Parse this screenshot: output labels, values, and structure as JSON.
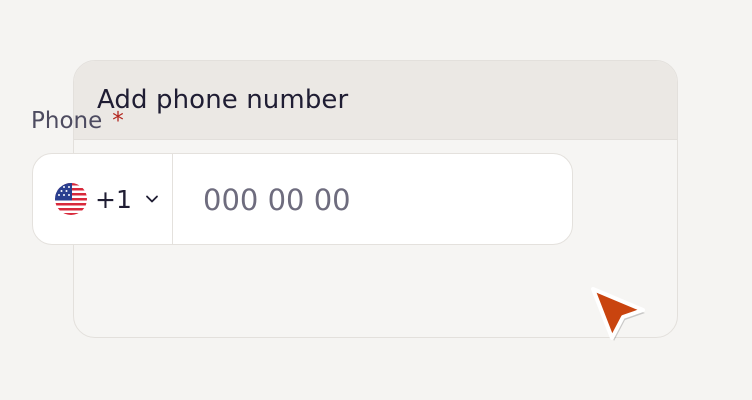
{
  "card": {
    "title": "Add phone number"
  },
  "phone_field": {
    "label": "Phone",
    "required_mark": "*",
    "country": {
      "flag_icon": "us-flag-icon",
      "dial_code": "+1",
      "chevron_icon": "chevron-down-icon"
    },
    "input": {
      "value": "",
      "placeholder": "000 00 00"
    }
  },
  "cursor": {
    "icon": "pointer-cursor-icon",
    "color": "#c9440f"
  },
  "colors": {
    "background": "#f5f4f2",
    "header_background": "#ebe8e4",
    "text_primary": "#1f1d33",
    "required": "#b3261e"
  }
}
